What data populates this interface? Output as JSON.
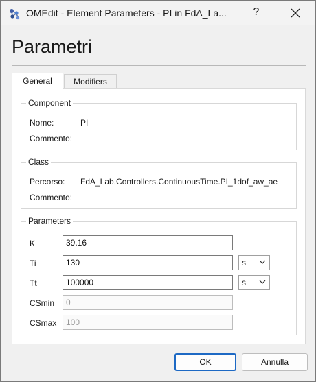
{
  "window": {
    "title": "OMEdit - Element Parameters - PI in FdA_La...",
    "help_label": "?"
  },
  "heading": "Parametri",
  "tabs": [
    {
      "label": "General",
      "active": true
    },
    {
      "label": "Modifiers",
      "active": false
    }
  ],
  "component": {
    "group_title": "Component",
    "name_label": "Nome:",
    "name_value": "PI",
    "comment_label": "Commento:",
    "comment_value": ""
  },
  "class": {
    "group_title": "Class",
    "path_label": "Percorso:",
    "path_value": "FdA_Lab.Controllers.ContinuousTime.PI_1dof_aw_ae",
    "comment_label": "Commento:",
    "comment_value": ""
  },
  "parameters": {
    "group_title": "Parameters",
    "rows": [
      {
        "label": "K",
        "value": "39.16",
        "placeholder": "",
        "unit": ""
      },
      {
        "label": "Ti",
        "value": "130",
        "placeholder": "",
        "unit": "s"
      },
      {
        "label": "Tt",
        "value": "100000",
        "placeholder": "",
        "unit": "s"
      },
      {
        "label": "CSmin",
        "value": "",
        "placeholder": "0",
        "unit": ""
      },
      {
        "label": "CSmax",
        "value": "",
        "placeholder": "100",
        "unit": ""
      }
    ]
  },
  "buttons": {
    "ok": "OK",
    "cancel": "Annulla"
  },
  "colors": {
    "accent": "#1d69c4",
    "window_bg": "#f0f0f0",
    "panel_bg": "#ffffff"
  },
  "icons": {
    "app": "omedit-app-icon",
    "close": "close-icon",
    "dropdown": "chevron-down-icon"
  }
}
